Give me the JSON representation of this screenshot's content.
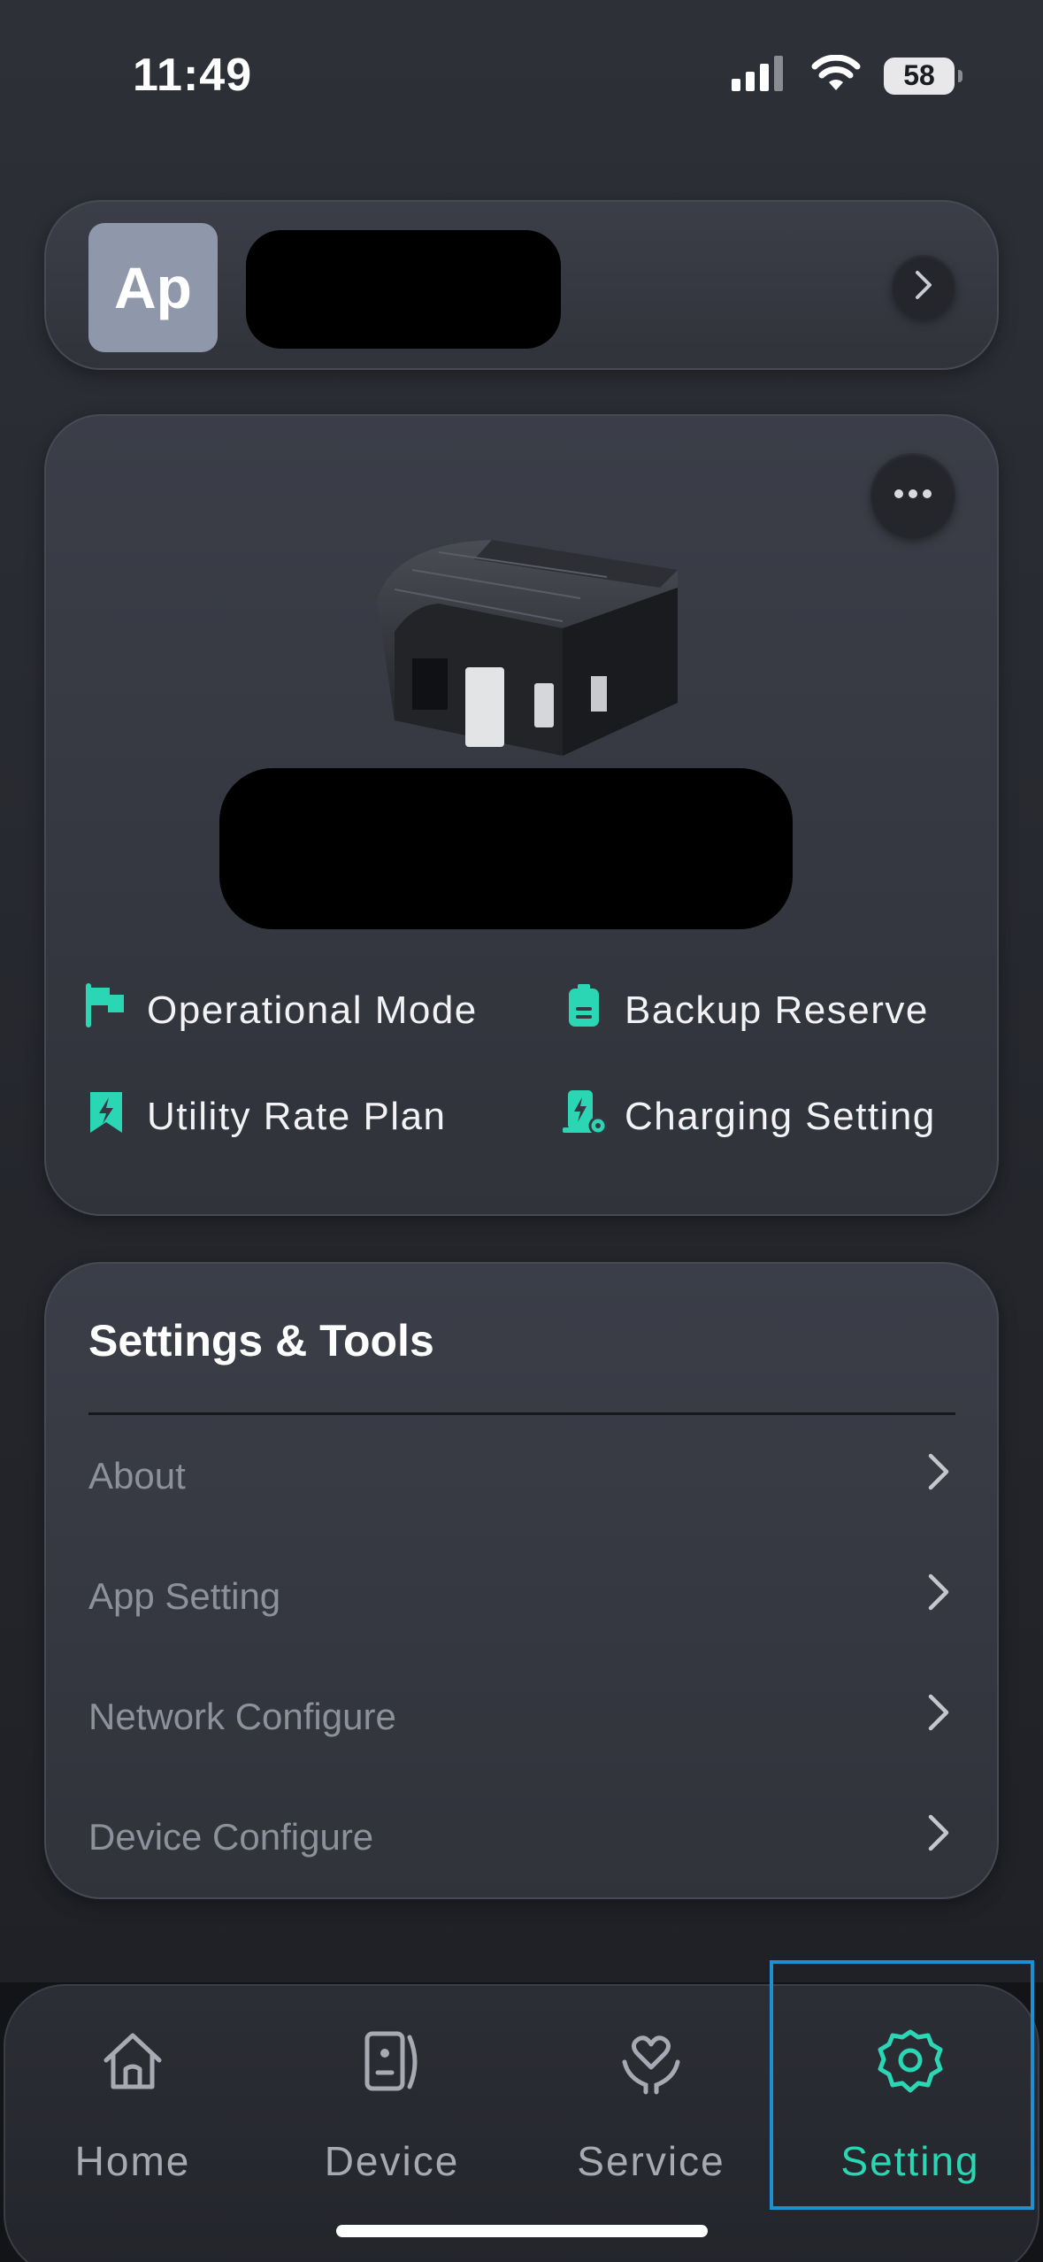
{
  "status_bar": {
    "time": "11:49",
    "battery": "58"
  },
  "account": {
    "avatar_initials": "Ap"
  },
  "device_shortcuts": {
    "operational_mode": "Operational Mode",
    "backup_reserve": "Backup Reserve",
    "utility_rate_plan": "Utility Rate Plan",
    "charging_setting": "Charging Setting"
  },
  "settings": {
    "title": "Settings & Tools",
    "items": [
      {
        "label": "About"
      },
      {
        "label": "App Setting"
      },
      {
        "label": "Network Configure"
      },
      {
        "label": "Device Configure"
      }
    ]
  },
  "bottom_nav": {
    "home": "Home",
    "device": "Device",
    "service": "Service",
    "setting": "Setting"
  },
  "colors": {
    "accent": "#2bd6b4",
    "background": "#2a2c33",
    "card": "#363841",
    "muted_text": "#8d919c"
  }
}
